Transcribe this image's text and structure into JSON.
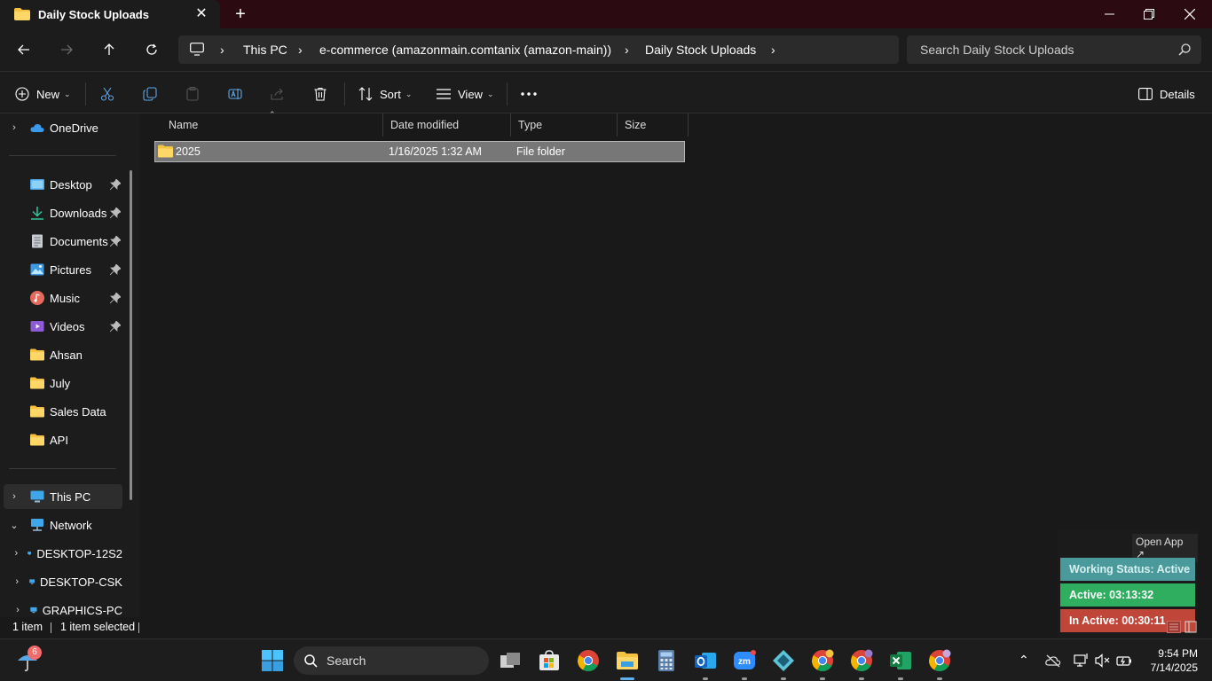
{
  "window": {
    "tab_title": "Daily Stock Uploads"
  },
  "address": {
    "crumbs": [
      "This PC",
      "e-commerce (amazonmain.comtanix (amazon-main))",
      "Daily Stock Uploads"
    ],
    "search_placeholder": "Search Daily Stock Uploads"
  },
  "commandbar": {
    "new_label": "New",
    "sort_label": "Sort",
    "view_label": "View",
    "details_label": "Details"
  },
  "navpane": {
    "onedrive": "OneDrive",
    "quick_access": [
      {
        "label": "Desktop"
      },
      {
        "label": "Downloads"
      },
      {
        "label": "Documents"
      },
      {
        "label": "Pictures"
      },
      {
        "label": "Music"
      },
      {
        "label": "Videos"
      },
      {
        "label": "Ahsan"
      },
      {
        "label": "July"
      },
      {
        "label": "Sales Data"
      },
      {
        "label": "API"
      }
    ],
    "this_pc": "This PC",
    "network": "Network",
    "network_children": [
      "DESKTOP-12S2",
      "DESKTOP-CSK",
      "GRAPHICS-PC"
    ]
  },
  "columns": {
    "name": "Name",
    "date_modified": "Date modified",
    "type": "Type",
    "size": "Size"
  },
  "files": [
    {
      "name": "2025",
      "date_modified": "1/16/2025 1:32 AM",
      "type": "File folder",
      "size": ""
    }
  ],
  "status": {
    "item_count": "1 item",
    "selected": "1 item selected"
  },
  "widget": {
    "open_app": "Open App ↗",
    "working_status": "Working Status: Active",
    "active": "Active: 03:13:32",
    "inactive": "In Active: 00:30:11",
    "colors": {
      "status": "#4a9a9c",
      "active": "#2fae60",
      "inactive": "#c0463a"
    }
  },
  "taskbar": {
    "search_label": "Search",
    "weather_badge": "6",
    "time": "9:54 PM",
    "date": "7/14/2025"
  }
}
